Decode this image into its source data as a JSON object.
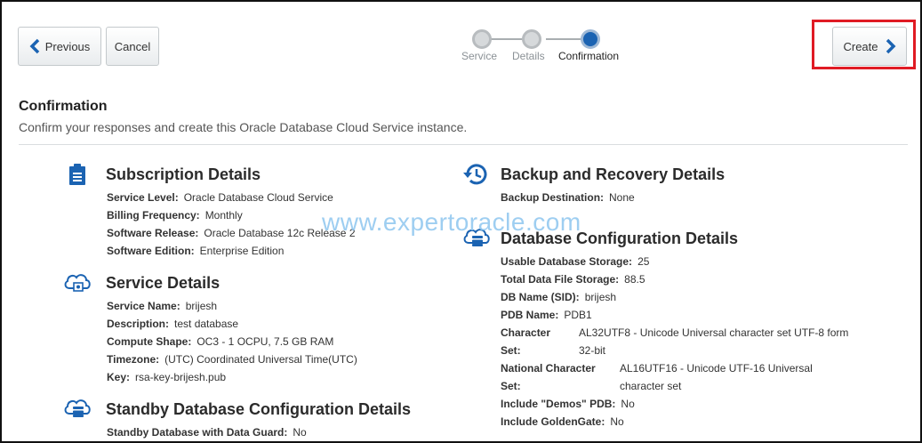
{
  "toolbar": {
    "previous_label": "Previous",
    "cancel_label": "Cancel",
    "create_label": "Create"
  },
  "train": {
    "steps": [
      "Service",
      "Details",
      "Confirmation"
    ],
    "current_index": 2
  },
  "page": {
    "title": "Confirmation",
    "subtitle": "Confirm your responses and create this Oracle Database Cloud Service instance."
  },
  "watermark": "www.expertoracle.com",
  "subscription": {
    "title": "Subscription Details",
    "rows": [
      {
        "k": "Service Level:",
        "v": "Oracle Database Cloud Service"
      },
      {
        "k": "Billing Frequency:",
        "v": "Monthly"
      },
      {
        "k": "Software Release:",
        "v": "Oracle Database 12c Release 2"
      },
      {
        "k": "Software Edition:",
        "v": "Enterprise Edition"
      }
    ]
  },
  "service": {
    "title": "Service Details",
    "rows": [
      {
        "k": "Service Name:",
        "v": "brijesh"
      },
      {
        "k": "Description:",
        "v": "test database"
      },
      {
        "k": "Compute Shape:",
        "v": "OC3 - 1 OCPU, 7.5 GB RAM"
      },
      {
        "k": "Timezone:",
        "v": "(UTC) Coordinated Universal Time(UTC)"
      },
      {
        "k": "Key:",
        "v": "rsa-key-brijesh.pub"
      }
    ]
  },
  "standby": {
    "title": "Standby Database Configuration Details",
    "rows": [
      {
        "k": "Standby Database with Data Guard:",
        "v": "No"
      }
    ]
  },
  "backup": {
    "title": "Backup and Recovery Details",
    "rows": [
      {
        "k": "Backup Destination:",
        "v": "None"
      }
    ]
  },
  "dbconfig": {
    "title": "Database Configuration Details",
    "rows": [
      {
        "k": "Usable Database Storage:",
        "v": "25"
      },
      {
        "k": "Total Data File Storage:",
        "v": "88.5"
      },
      {
        "k": "DB Name (SID):",
        "v": "brijesh"
      },
      {
        "k": "PDB Name:",
        "v": "PDB1"
      }
    ],
    "character_set": {
      "k1": "Character",
      "k2": "Set:",
      "v1": "AL32UTF8 - Unicode Universal character set UTF-8 form",
      "v2": "32-bit"
    },
    "national_character_set": {
      "k1": "National Character",
      "k2": "Set:",
      "v1": "AL16UTF16 - Unicode UTF-16 Universal",
      "v2": "character set"
    },
    "rows2": [
      {
        "k": "Include \"Demos\" PDB:",
        "v": "No"
      },
      {
        "k": "Include GoldenGate:",
        "v": "No"
      }
    ]
  },
  "colors": {
    "accent": "#1b63b2",
    "highlight": "#e01b24",
    "watermark": "#8ec6ef"
  }
}
